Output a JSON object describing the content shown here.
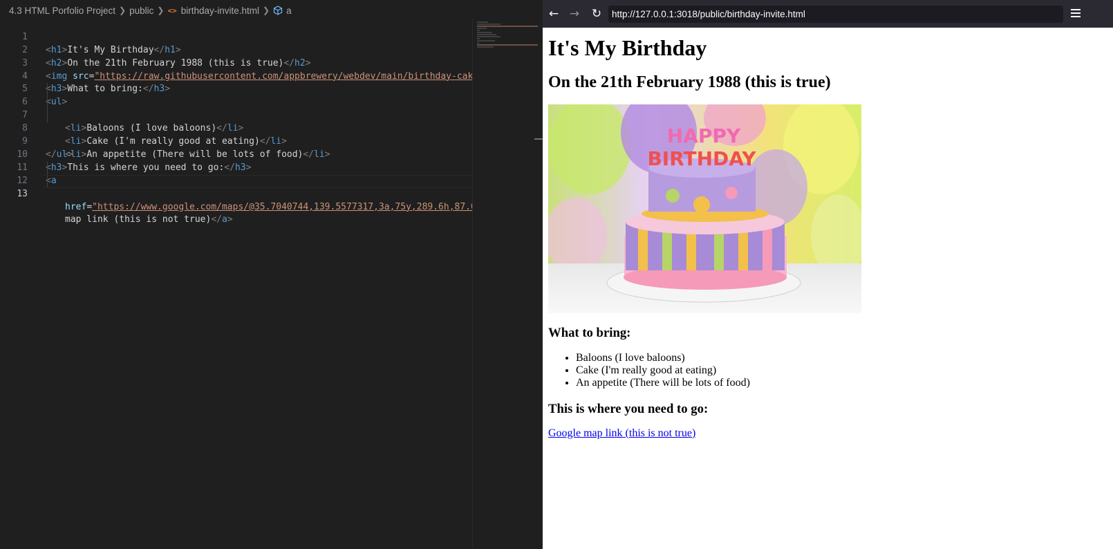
{
  "editor": {
    "breadcrumb": {
      "project": "4.3 HTML Porfolio Project",
      "folder": "public",
      "file": "birthday-invite.html",
      "symbol": "a",
      "file_icon": "<>",
      "symbol_icon": "cube-symbol-icon"
    },
    "line_numbers": [
      "1",
      "2",
      "3",
      "4",
      "5",
      "6",
      "7",
      "8",
      "9",
      "10",
      "11",
      "12",
      "13"
    ],
    "code": {
      "l1": {
        "tag": "h1",
        "text": "It's My Birthday"
      },
      "l2": {
        "tag": "h2",
        "text": "On the 21th February 1988 (this is true)"
      },
      "l3": {
        "tag": "img",
        "attr": "src",
        "value": "\"https://raw.githubusercontent.com/appbrewery/webdev/main/birthday-cake3.4"
      },
      "l4": {
        "tag": "h3",
        "text": "What to bring:"
      },
      "l5": {
        "tag": "ul"
      },
      "l6": {
        "tag": "li",
        "text": "Baloons (I love baloons)"
      },
      "l7": {
        "tag": "li",
        "text": "Cake (I'm really good at eating)"
      },
      "l8": {
        "tag": "li",
        "text": "An appetite (There will be lots of food)"
      },
      "l9": {
        "tag": "ul"
      },
      "l10": {
        "tag": "h3",
        "text": "This is where you need to go:"
      },
      "l11": {
        "tag": "a"
      },
      "l12": {
        "attr": "href",
        "value": "\"https://www.google.com/maps/@35.7040744,139.5577317,3a,75y,289.6h,87.01t,"
      },
      "l13": {
        "text": "map link (this is not true)",
        "tag": "a"
      }
    }
  },
  "browser": {
    "url": "http://127.0.0.1:3018/public/birthday-invite.html",
    "back_icon": "←",
    "forward_icon": "→",
    "reload_icon": "↻",
    "page": {
      "h1": "It's My Birthday",
      "h2": "On the 21th February 1988 (this is true)",
      "h3_bring": "What to bring:",
      "items": [
        "Baloons (I love baloons)",
        "Cake (I'm really good at eating)",
        "An appetite (There will be lots of food)"
      ],
      "h3_go": "This is where you need to go:",
      "link": "Google map link (this is not true)",
      "cake_text_top": "HAPPY",
      "cake_text_bottom": "BIRTHDAY"
    }
  },
  "colors": {
    "editor_bg": "#1f1f1f",
    "tag": "#569cd6",
    "attr": "#9cdcfe",
    "string": "#ce9178",
    "link": "#0000ee"
  }
}
